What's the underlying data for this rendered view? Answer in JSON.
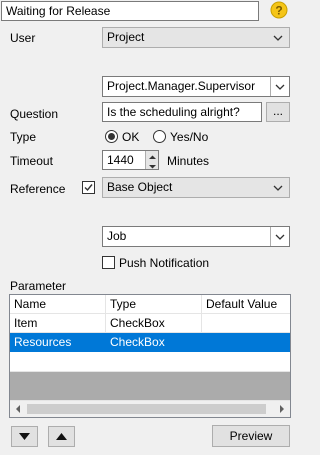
{
  "header": {
    "title_value": "Waiting for Release",
    "help_icon": "help-question-icon"
  },
  "user": {
    "label": "User",
    "selected": "Project"
  },
  "role": {
    "selected": "Project.Manager.Supervisor"
  },
  "question": {
    "label": "Question",
    "value": "Is the scheduling alright?",
    "browse_label": "..."
  },
  "type": {
    "label": "Type",
    "options": [
      "OK",
      "Yes/No"
    ],
    "selected": "OK"
  },
  "timeout": {
    "label": "Timeout",
    "value": "1440",
    "unit": "Minutes"
  },
  "reference": {
    "label": "Reference",
    "checked": true,
    "selected": "Base Object"
  },
  "object": {
    "selected": "Job"
  },
  "push": {
    "label": "Push Notification",
    "checked": false
  },
  "parameter": {
    "label": "Parameter",
    "columns": [
      "Name",
      "Type",
      "Default Value"
    ],
    "rows": [
      {
        "name": "Item",
        "type": "CheckBox",
        "default": ""
      },
      {
        "name": "Resources",
        "type": "CheckBox",
        "default": "",
        "selected": true
      }
    ]
  },
  "footer": {
    "preview_label": "Preview"
  },
  "colors": {
    "selection": "#0078d7",
    "help_icon": "#f5c518",
    "background": "#f0f0f0"
  }
}
